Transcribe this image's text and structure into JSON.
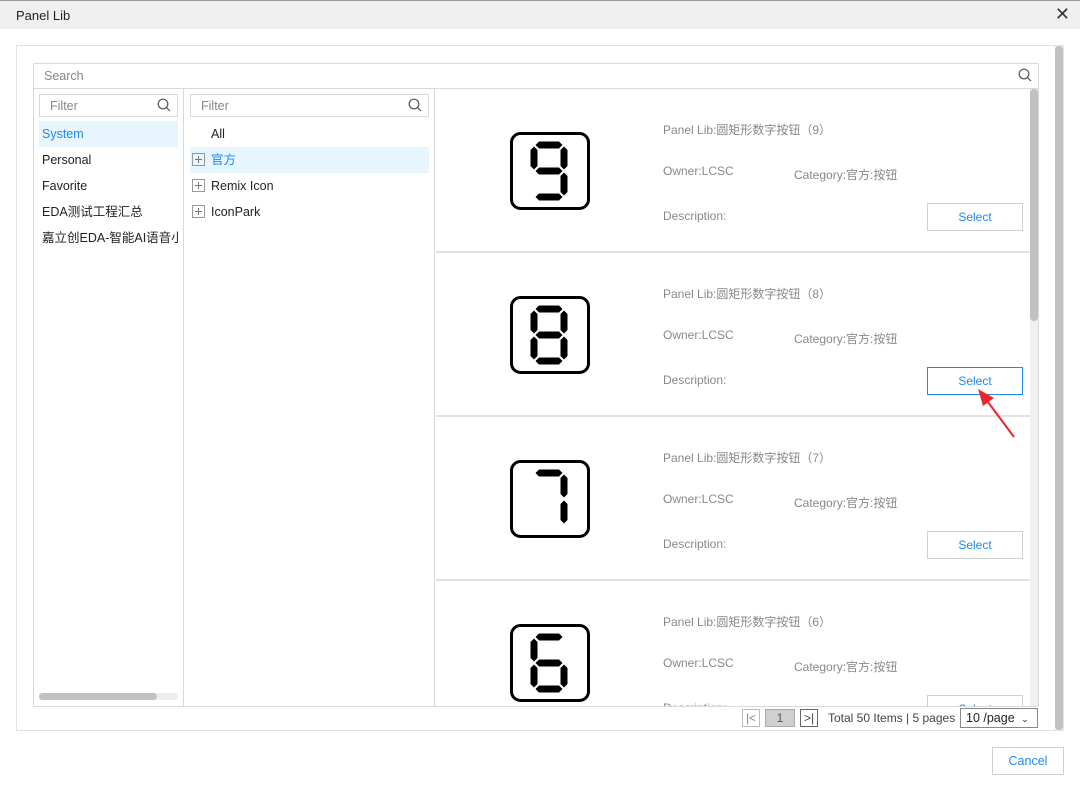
{
  "window": {
    "title": "Panel Lib",
    "close_icon": "close-icon"
  },
  "search": {
    "placeholder": "Search"
  },
  "libraries": {
    "filter_placeholder": "Filter",
    "items": [
      {
        "label": "System",
        "selected": true
      },
      {
        "label": "Personal"
      },
      {
        "label": "Favorite"
      },
      {
        "label": "EDA测试工程汇总"
      },
      {
        "label": "嘉立创EDA-智能AI语音小"
      }
    ]
  },
  "categories": {
    "filter_placeholder": "Filter",
    "all_label": "All",
    "items": [
      {
        "label": "官方",
        "selected": true
      },
      {
        "label": "Remix Icon"
      },
      {
        "label": "IconPark"
      }
    ]
  },
  "panels": [
    {
      "digit": 9,
      "name": "Panel Lib:圆矩形数字按钮（9）",
      "owner": "Owner:LCSC",
      "category": "Category:官方:按钮",
      "description": "Description:",
      "select_label": "Select"
    },
    {
      "digit": 8,
      "name": "Panel Lib:圆矩形数字按钮（8）",
      "owner": "Owner:LCSC",
      "category": "Category:官方:按钮",
      "description": "Description:",
      "select_label": "Select",
      "highlighted": true
    },
    {
      "digit": 7,
      "name": "Panel Lib:圆矩形数字按钮（7）",
      "owner": "Owner:LCSC",
      "category": "Category:官方:按钮",
      "description": "Description:",
      "select_label": "Select"
    },
    {
      "digit": 6,
      "name": "Panel Lib:圆矩形数字按钮（6）",
      "owner": "Owner:LCSC",
      "category": "Category:官方:按钮",
      "description": "Description:",
      "select_label": "Select"
    }
  ],
  "pagination": {
    "first": "|<",
    "current": "1",
    "last": ">|",
    "total": "Total 50 Items | 5 pages",
    "page_size": "10 /page"
  },
  "footer": {
    "cancel_label": "Cancel"
  },
  "colors": {
    "accent": "#1e88f0",
    "selected_bg": "#e6f5fe",
    "annotation_arrow": "#e8282b"
  }
}
